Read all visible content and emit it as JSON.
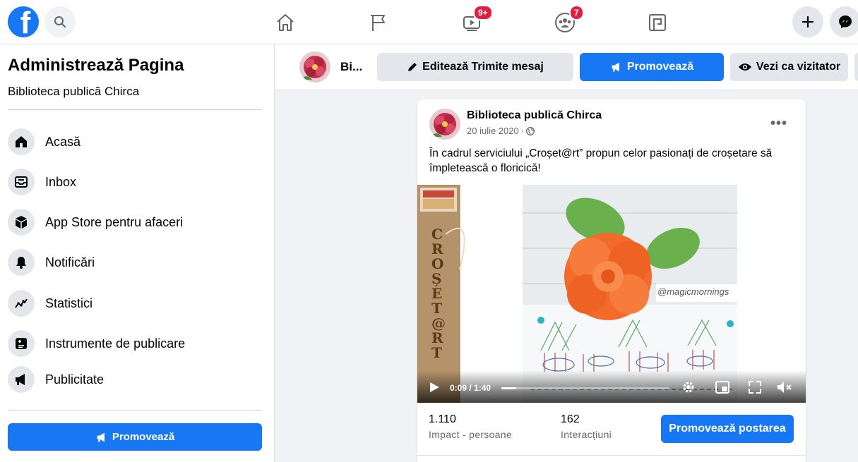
{
  "topbar": {
    "logo_letter": "f",
    "badges": {
      "watch": "9+",
      "groups": "7"
    }
  },
  "sidebar": {
    "title": "Administrează Pagina",
    "subtitle": "Biblioteca publică Chirca",
    "items": [
      {
        "label": "Acasă",
        "icon": "home-icon"
      },
      {
        "label": "Inbox",
        "icon": "inbox-icon"
      },
      {
        "label": "App Store pentru afaceri",
        "icon": "cube-icon"
      },
      {
        "label": "Notificări",
        "icon": "bell-icon"
      },
      {
        "label": "Statistici",
        "icon": "trend-icon"
      },
      {
        "label": "Instrumente de publicare",
        "icon": "publishing-tools-icon"
      },
      {
        "label": "Publicitate",
        "icon": "megaphone-icon"
      }
    ],
    "promote_label": "Promovează"
  },
  "actionbar": {
    "page_name_short": "Bi...",
    "edit_label": "Editează Trimite mesaj",
    "promote_label": "Promovează",
    "view_as_label": "Vezi ca vizitator"
  },
  "post": {
    "author": "Biblioteca publică Chirca",
    "date": "20 iulie 2020",
    "text": "În cadrul serviciului „Croșet@rt” propun celor pasionați de croșetare să împletească o floricică!",
    "video": {
      "time": "0:09 / 1:40",
      "progress": 0.09,
      "overlay_vertical_text": "CROȘET@RT",
      "watermark": "@magicmornings"
    },
    "stats": [
      {
        "value": "1.110",
        "label": "Impact - persoane"
      },
      {
        "value": "162",
        "label": "Interacțiuni"
      }
    ],
    "boost_label": "Promovează postarea"
  },
  "colors": {
    "brand": "#1877f2",
    "badge": "#e41e3f",
    "background": "#f0f2f5"
  }
}
